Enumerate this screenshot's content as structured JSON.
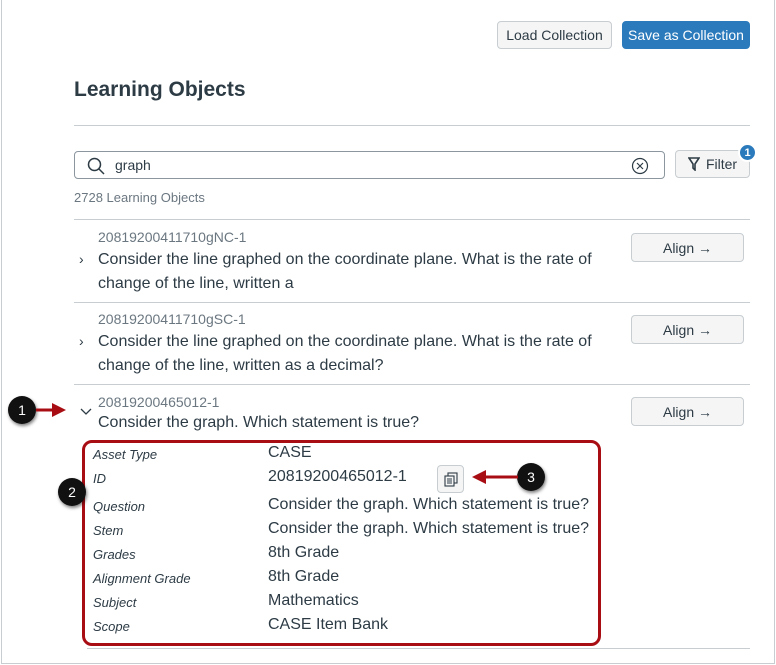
{
  "header": {
    "load_label": "Load Collection",
    "save_label": "Save as Collection"
  },
  "title": "Learning Objects",
  "search": {
    "value": "graph",
    "filter_label": "Filter",
    "filter_badge": "1"
  },
  "count": "2728 Learning Objects",
  "align_label": "Align",
  "items": [
    {
      "id": "20819200411710gNC-1",
      "line1": "Consider the line graphed on the coordinate plane. What is the rate of",
      "line2": "change of the line, written a"
    },
    {
      "id": "20819200411710gSC-1",
      "line1": "Consider the line graphed on the coordinate plane. What is the rate of",
      "line2": "change of the line, written as a decimal?"
    },
    {
      "id": "20819200465012-1",
      "line1": "Consider the graph. Which statement is true?"
    }
  ],
  "details": [
    {
      "label": "Asset Type",
      "value": "CASE"
    },
    {
      "label": "ID",
      "value": "20819200465012-1"
    },
    {
      "label": "Question",
      "value": "Consider the graph. Which statement is true?"
    },
    {
      "label": "Stem",
      "value": "Consider the graph. Which statement is true?"
    },
    {
      "label": "Grades",
      "value": "8th Grade"
    },
    {
      "label": "Alignment Grade",
      "value": "8th Grade"
    },
    {
      "label": "Subject",
      "value": "Mathematics"
    },
    {
      "label": "Scope",
      "value": "CASE Item Bank"
    }
  ],
  "callouts": [
    "1",
    "2",
    "3"
  ],
  "colors": {
    "primary": "#2b7abc",
    "annotation": "#a80d14"
  }
}
